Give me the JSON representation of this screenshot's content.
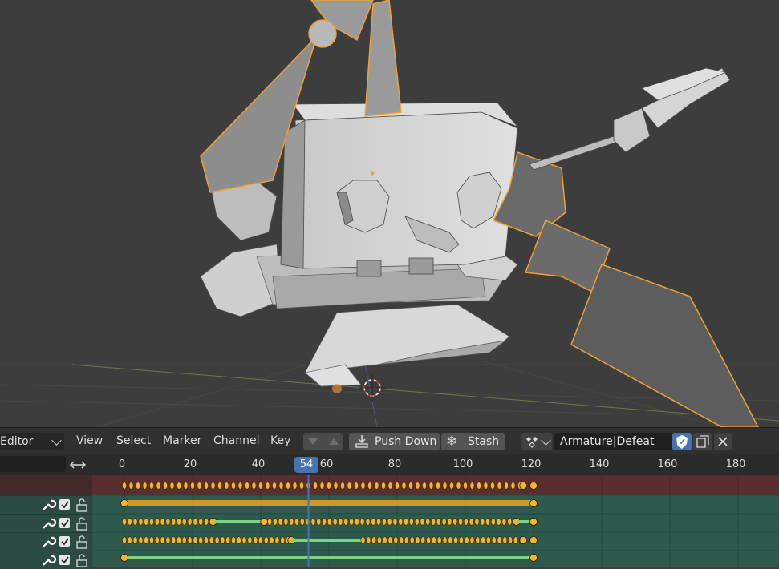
{
  "header": {
    "editor_type": "Editor",
    "menus": [
      "View",
      "Select",
      "Marker",
      "Channel",
      "Key"
    ],
    "push_down_label": "Push Down",
    "stash_label": "Stash",
    "action_name": "Armature|Defeat"
  },
  "timeline": {
    "ticks": [
      "0",
      "20",
      "40",
      "60",
      "80",
      "100",
      "120",
      "140",
      "160",
      "180"
    ],
    "current_frame": "54"
  },
  "colors": {
    "selection_outline": "#f0a035",
    "keyframe_fill": "#f5b42a",
    "summary_row": "#5a2e2e",
    "channel_row": "#2e5a4e",
    "playhead": "#4772b3"
  },
  "icons": {
    "modifier": "wrench-icon",
    "checkbox": "checkbox-checked-icon",
    "lock": "lock-open-icon",
    "fake_user": "shield-icon",
    "copy": "copy-icon",
    "close": "close-icon"
  }
}
